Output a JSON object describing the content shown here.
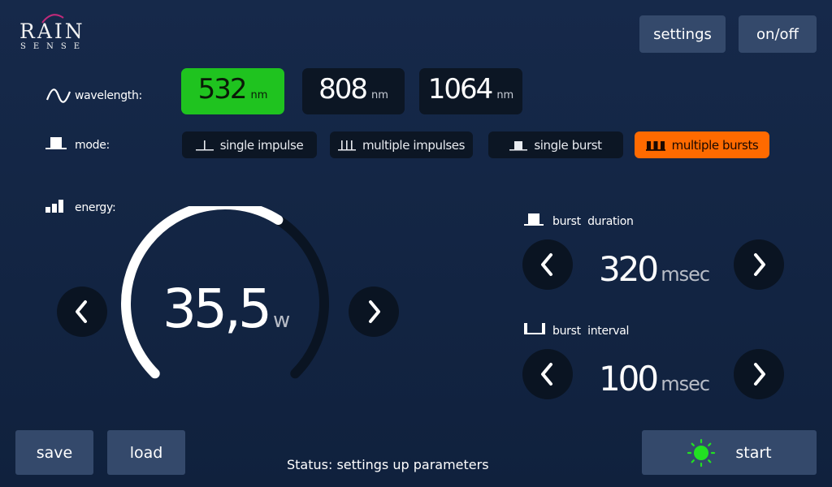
{
  "logo": {
    "main": "RAIN",
    "sub": "SENSE"
  },
  "header": {
    "settings_label": "settings",
    "onoff_label": "on/off"
  },
  "wavelength": {
    "label": "wavelength:",
    "options": [
      {
        "value": "532",
        "unit": "nm",
        "active": true
      },
      {
        "value": "808",
        "unit": "nm",
        "active": false
      },
      {
        "value": "1064",
        "unit": "nm",
        "active": false
      }
    ]
  },
  "mode": {
    "label": "mode:",
    "options": [
      {
        "label": "single impulse",
        "icon": "single-impulse-icon",
        "active": false
      },
      {
        "label": "multiple impulses",
        "icon": "multiple-impulses-icon",
        "active": false
      },
      {
        "label": "single burst",
        "icon": "single-burst-icon",
        "active": false
      },
      {
        "label": "multiple bursts",
        "icon": "multiple-bursts-icon",
        "active": true
      }
    ]
  },
  "energy": {
    "label": "energy:",
    "value": "35,5",
    "unit": "w",
    "gauge_fraction": 0.62
  },
  "burst_duration": {
    "label": "burst  duration",
    "value": "320",
    "unit": "msec"
  },
  "burst_interval": {
    "label": "burst  interval",
    "value": "100",
    "unit": "msec"
  },
  "footer": {
    "save_label": "save",
    "load_label": "load",
    "status": "Status: settings up parameters",
    "start_label": "start"
  },
  "colors": {
    "background": "#13264a",
    "active_wavelength": "#1fc31f",
    "active_mode": "#ff6a00",
    "button": "#34496b",
    "start_indicator": "#22e022"
  }
}
